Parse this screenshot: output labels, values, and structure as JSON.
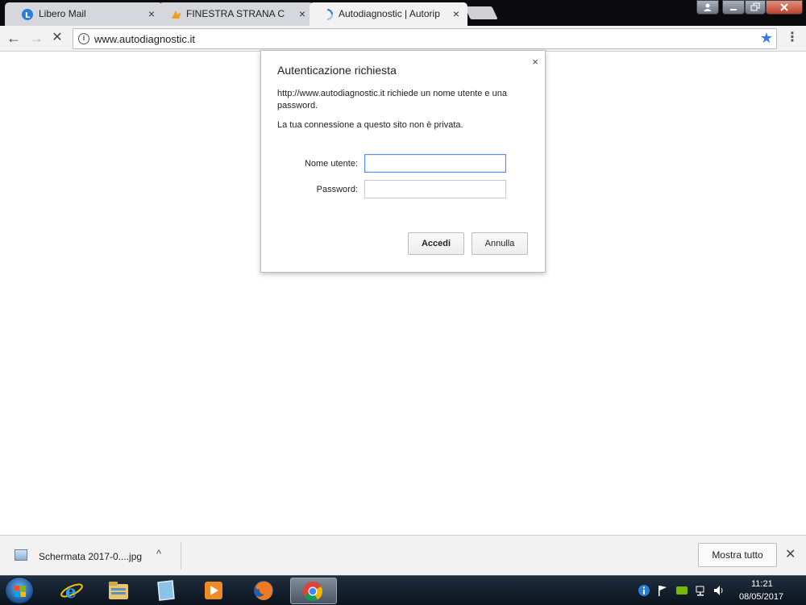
{
  "browser": {
    "tabs": [
      {
        "title": "Libero Mail",
        "active": false,
        "icon": "libero-icon"
      },
      {
        "title": "FINESTRA STRANA CHE",
        "active": false,
        "icon": "forum-icon"
      },
      {
        "title": "Autodiagnostic | Autorip",
        "active": true,
        "icon": "loading-spinner-icon"
      }
    ],
    "close_glyph": "×",
    "url": "www.autodiagnostic.it",
    "nav": {
      "back": "←",
      "forward": "→",
      "stop": "✕",
      "menu": "⋮",
      "star": "★",
      "info": "i"
    }
  },
  "dialog": {
    "title": "Autenticazione richiesta",
    "close": "×",
    "message": "http://www.autodiagnostic.it richiede un nome utente e una password.",
    "warning": "La tua connessione a questo sito non è privata.",
    "username_label": "Nome utente:",
    "username_value": "",
    "password_label": "Password:",
    "password_value": "",
    "login_label": "Accedi",
    "cancel_label": "Annulla"
  },
  "downloads": {
    "filename": "Schermata 2017-0....jpg",
    "chevron": "^",
    "show_all_label": "Mostra tutto",
    "close": "✕"
  },
  "taskbar": {
    "apps": [
      "internet-explorer-icon",
      "file-explorer-icon",
      "notes-icon",
      "media-player-icon",
      "firefox-icon",
      "chrome-icon"
    ],
    "clock_time": "11:21",
    "clock_date": "08/05/2017"
  },
  "colors": {
    "accent_blue": "#3b78e7",
    "focus_border": "#4d90fe",
    "tabstrip_bg": "#0b0b0d"
  }
}
